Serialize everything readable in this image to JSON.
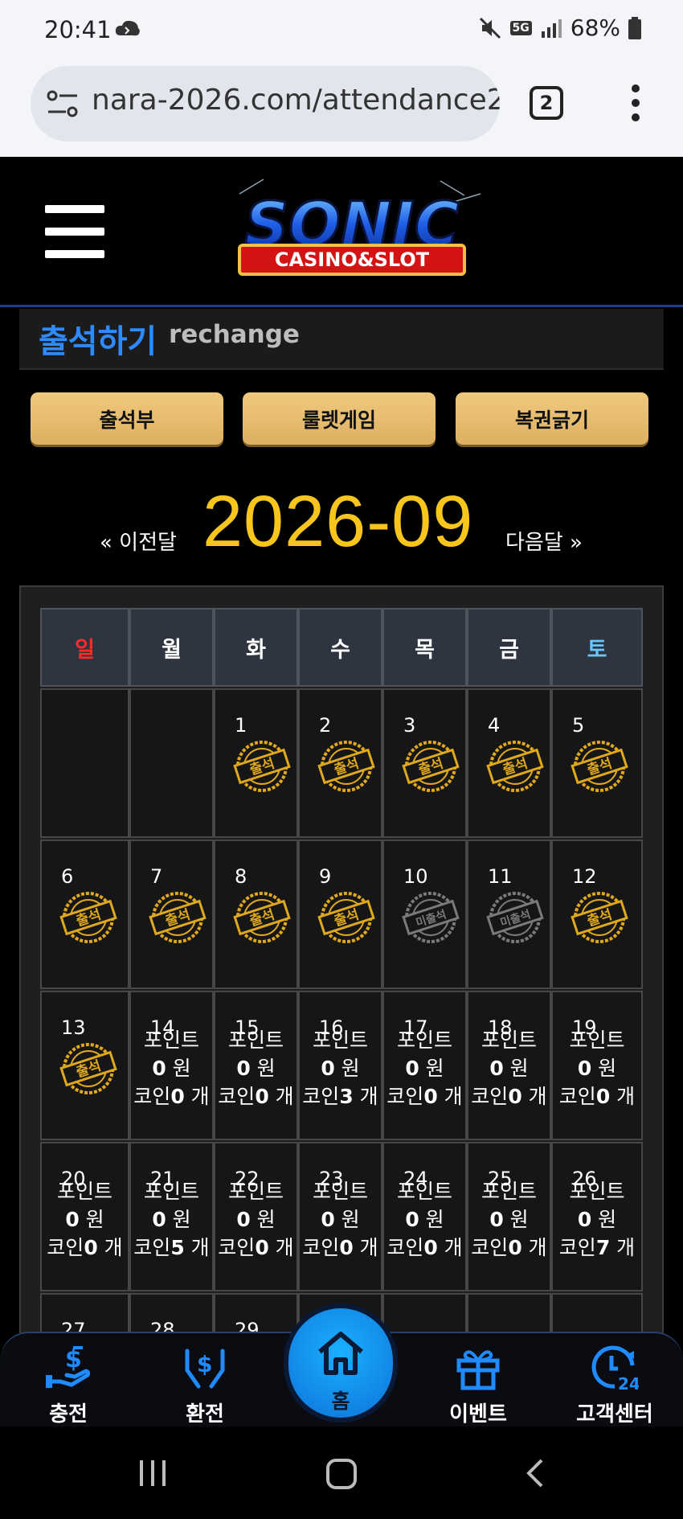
{
  "status": {
    "time": "20:41",
    "network": "5G",
    "battery": "68%"
  },
  "browser": {
    "url": "nara-2026.com/attendance2.",
    "tab_count": "2"
  },
  "logo": {
    "main": "SONIC",
    "sub": "CASINO&SLOT"
  },
  "section": {
    "title": "출석하기",
    "subtitle": "rechange"
  },
  "buttons": [
    "출석부",
    "룰렛게임",
    "복권긁기"
  ],
  "month": {
    "prev": "« 이전달",
    "title": "2026-09",
    "next": "다음달 »"
  },
  "weekdays": [
    "일",
    "월",
    "화",
    "수",
    "목",
    "금",
    "토"
  ],
  "weekday_colors": {
    "sunday": "#ff2a2a",
    "saturday": "#66c7ff",
    "default": "#ffffff"
  },
  "stamp_labels": {
    "attended": "출석",
    "absent": "미출석"
  },
  "calendar": [
    {
      "day": ""
    },
    {
      "day": ""
    },
    {
      "day": "1",
      "status": "attended"
    },
    {
      "day": "2",
      "status": "attended"
    },
    {
      "day": "3",
      "status": "attended"
    },
    {
      "day": "4",
      "status": "attended"
    },
    {
      "day": "5",
      "status": "attended"
    },
    {
      "day": "6",
      "status": "attended"
    },
    {
      "day": "7",
      "status": "attended"
    },
    {
      "day": "8",
      "status": "attended"
    },
    {
      "day": "9",
      "status": "attended"
    },
    {
      "day": "10",
      "status": "absent"
    },
    {
      "day": "11",
      "status": "absent"
    },
    {
      "day": "12",
      "status": "attended"
    },
    {
      "day": "13",
      "status": "attended"
    },
    {
      "day": "14",
      "status": "future",
      "point": "0",
      "coin": "0"
    },
    {
      "day": "15",
      "status": "future",
      "point": "0",
      "coin": "0"
    },
    {
      "day": "16",
      "status": "future",
      "point": "0",
      "coin": "3"
    },
    {
      "day": "17",
      "status": "future",
      "point": "0",
      "coin": "0"
    },
    {
      "day": "18",
      "status": "future",
      "point": "0",
      "coin": "0"
    },
    {
      "day": "19",
      "status": "future",
      "point": "0",
      "coin": "0"
    },
    {
      "day": "20",
      "status": "future",
      "point": "0",
      "coin": "0"
    },
    {
      "day": "21",
      "status": "future",
      "point": "0",
      "coin": "5"
    },
    {
      "day": "22",
      "status": "future",
      "point": "0",
      "coin": "0"
    },
    {
      "day": "23",
      "status": "future",
      "point": "0",
      "coin": "0"
    },
    {
      "day": "24",
      "status": "future",
      "point": "0",
      "coin": "0"
    },
    {
      "day": "25",
      "status": "future",
      "point": "0",
      "coin": "0"
    },
    {
      "day": "26",
      "status": "future",
      "point": "0",
      "coin": "7"
    },
    {
      "day": "27",
      "status": "future"
    },
    {
      "day": "28",
      "status": "future"
    },
    {
      "day": "29",
      "status": "future"
    },
    {
      "day": ""
    },
    {
      "day": ""
    },
    {
      "day": ""
    },
    {
      "day": ""
    }
  ],
  "reward_text": {
    "point_label": "포인트",
    "won_unit": "원",
    "coin_label": "코인",
    "coin_unit": "개"
  },
  "bottom_nav": [
    {
      "label": "충전",
      "icon": "charge-icon"
    },
    {
      "label": "환전",
      "icon": "exchange-icon"
    },
    {
      "label": "홈",
      "icon": "home-icon"
    },
    {
      "label": "이벤트",
      "icon": "gift-icon"
    },
    {
      "label": "고객센터",
      "icon": "support-24-icon"
    }
  ]
}
